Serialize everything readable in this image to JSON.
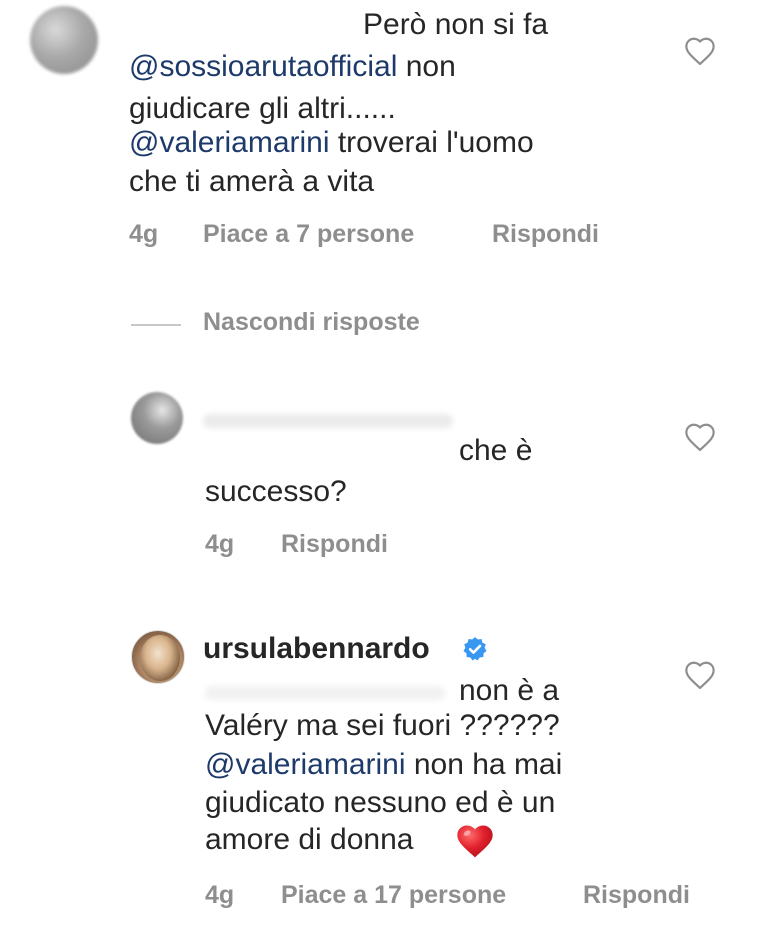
{
  "comment1": {
    "line1": "Però non si fa",
    "line2_mention": "@sossioarutaofficial",
    "line2_rest": " non",
    "line3": "giudicare gli altri......",
    "line4_mention": "@valeriamarini",
    "line4_rest": " troverai l'uomo",
    "line5": "che ti amerà a vita",
    "time": "4g",
    "likes": "Piace a 7 persone",
    "reply": "Rispondi"
  },
  "thread": {
    "hide_replies": "Nascondi risposte"
  },
  "reply1": {
    "line1": "che è",
    "line2": "successo?",
    "time": "4g",
    "reply": "Rispondi"
  },
  "reply2": {
    "username": "ursulabennardo",
    "line1": "non è a",
    "line2": "Valéry ma sei fuori ??????",
    "line3_mention": "@valeriamarini",
    "line3_rest": " non ha mai",
    "line4": "giudicato nessuno ed è un",
    "line5": "amore di donna",
    "time": "4g",
    "likes": "Piace a 17 persone",
    "reply": "Rispondi"
  },
  "icons": {
    "like": "heart-outline-icon",
    "verified": "verified-badge-icon",
    "emoji": "red-heart-emoji"
  },
  "colors": {
    "text": "#262626",
    "meta": "#8e8e8e",
    "mention": "#1d3a6b",
    "verified": "#3897f0",
    "emoji_heart": "#e0202c"
  }
}
